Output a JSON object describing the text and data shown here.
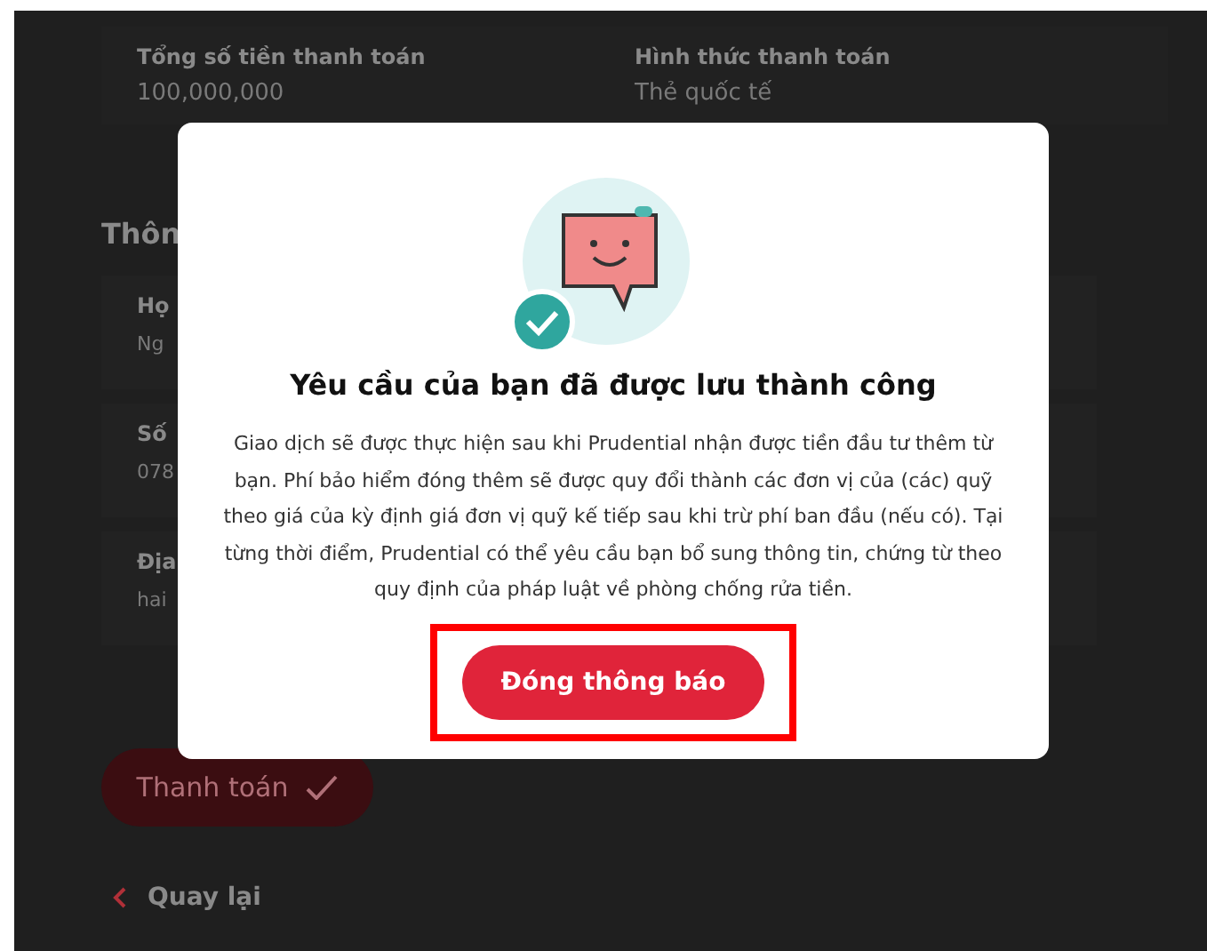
{
  "summary": {
    "fields": [
      {
        "label": "Tổng số tiền thanh toán",
        "value": "100,000,000"
      },
      {
        "label": "Hình thức thanh toán",
        "value": "Thẻ quốc tế"
      }
    ]
  },
  "section": {
    "title": "Thôn",
    "fields": [
      {
        "label": "Họ",
        "value": "Ng"
      },
      {
        "label": "Số",
        "value": "078"
      },
      {
        "label": "Địa",
        "value": "hai"
      }
    ]
  },
  "pay_button": {
    "label": "Thanh toán"
  },
  "back_link": {
    "label": "Quay lại"
  },
  "dialog": {
    "title": "Yêu cầu của bạn đã được lưu thành công",
    "message": "Giao dịch sẽ được thực hiện sau khi Prudential nhận được tiền đầu tư thêm từ bạn. Phí bảo hiểm đóng thêm sẽ được quy đổi thành các đơn vị của (các) quỹ theo giá của kỳ định giá đơn vị quỹ kế tiếp sau khi trừ phí ban đầu (nếu có). Tại từng thời điểm, Prudential có thể yêu cầu bạn bổ sung thông tin, chứng từ theo quy định của pháp luật về phòng chống rửa tiền.",
    "button": "Đóng thông báo",
    "highlighted": true
  }
}
